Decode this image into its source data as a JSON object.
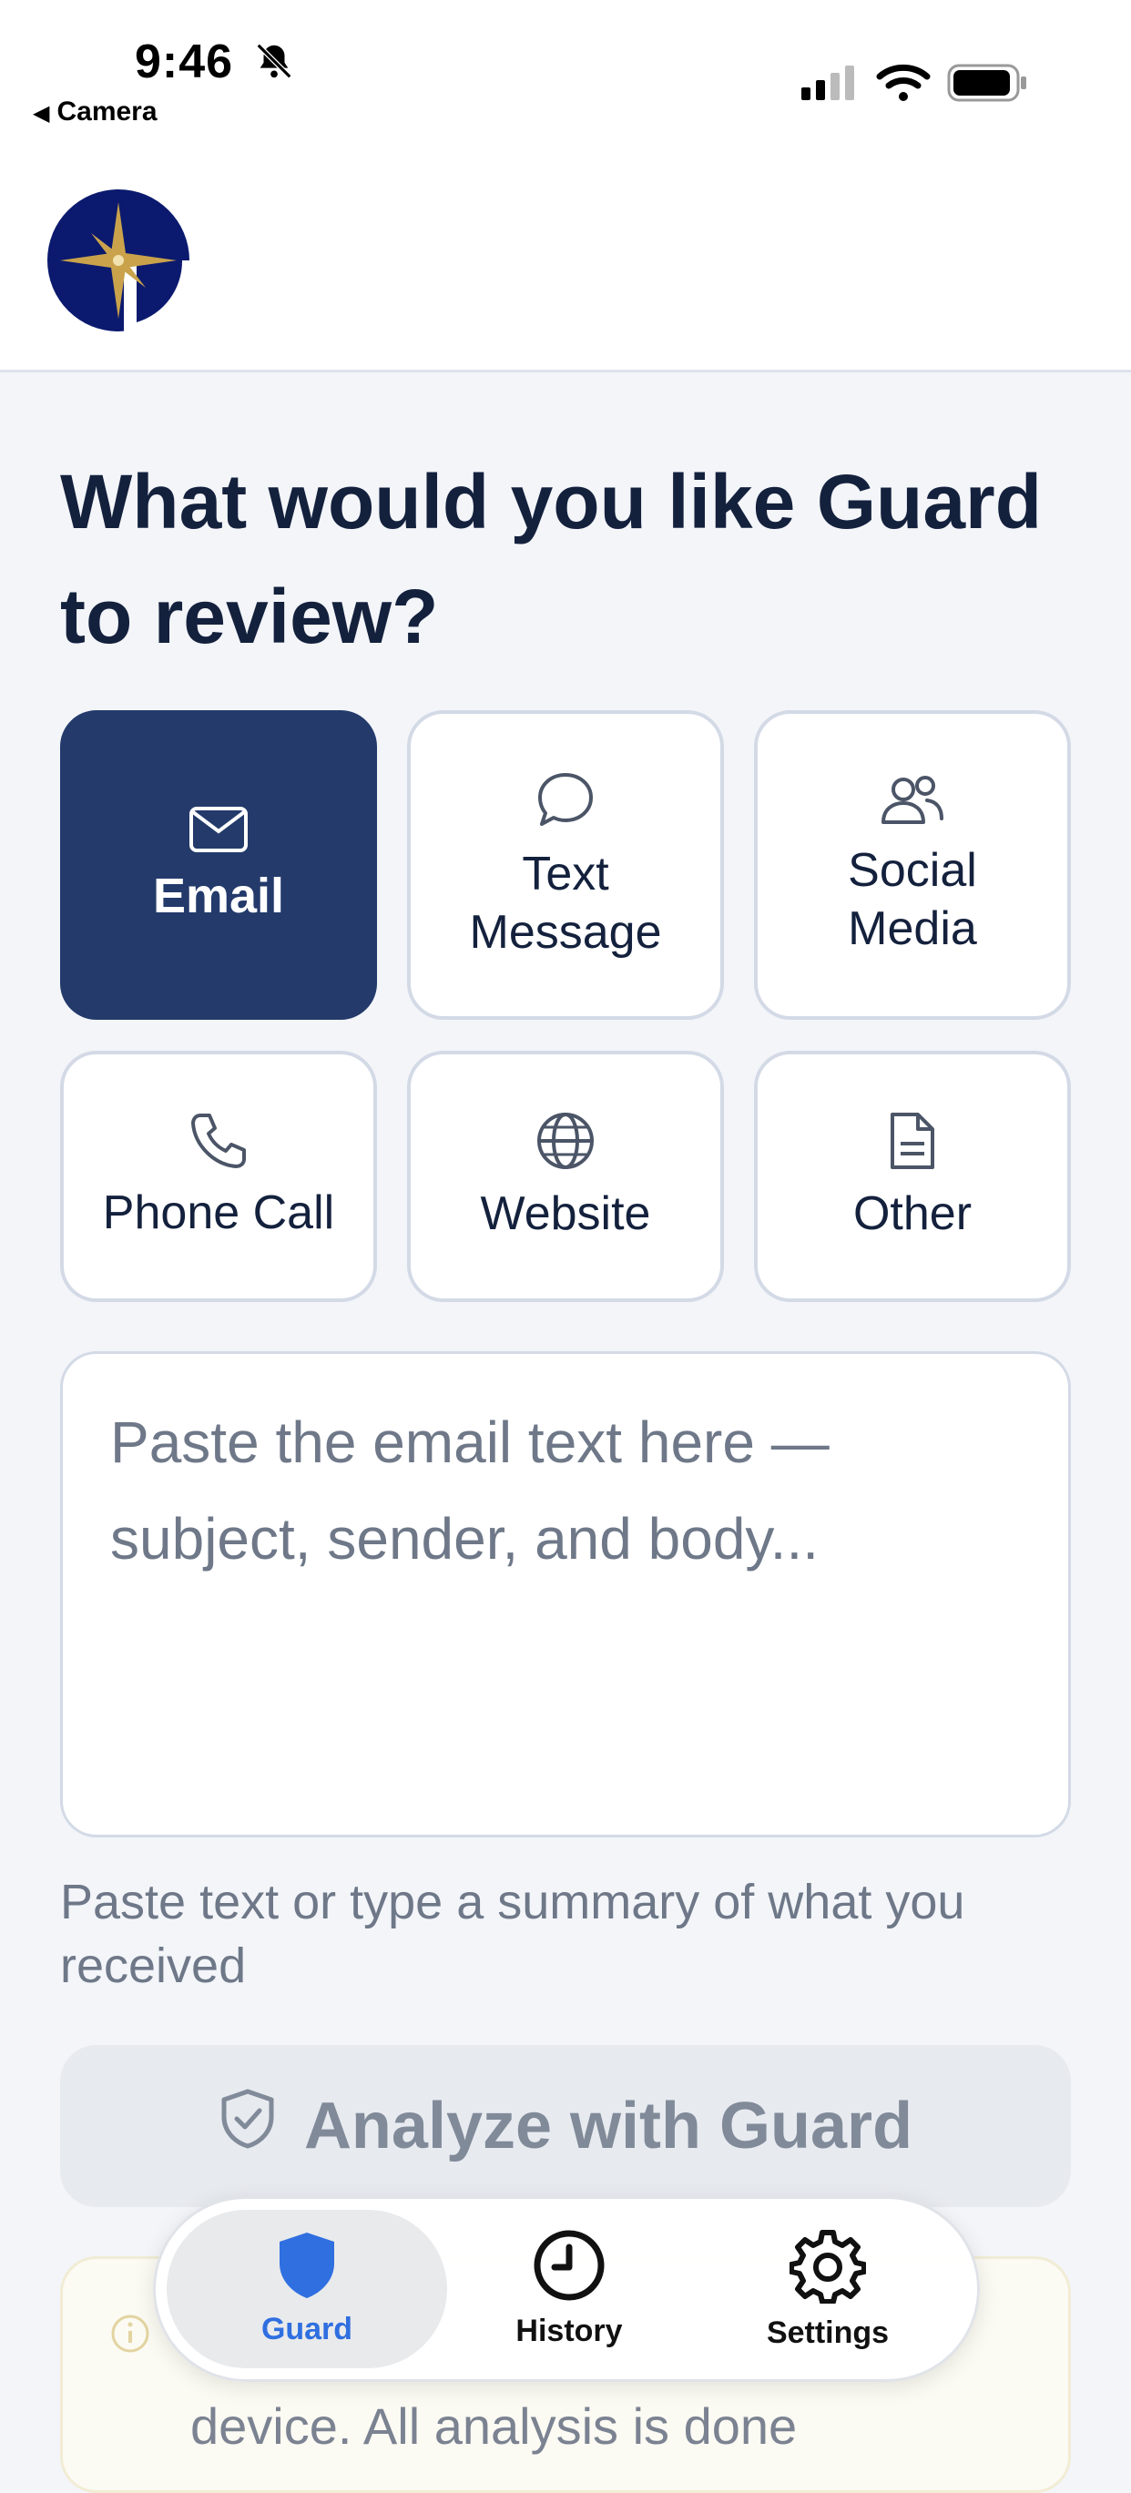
{
  "status_bar": {
    "time": "9:46",
    "back_label": "Camera"
  },
  "header": {
    "logo_icon": "compass-g-logo-icon"
  },
  "main": {
    "title": "What would you like Guard to review?",
    "options": [
      {
        "label": "Email",
        "icon": "mail-icon",
        "selected": true
      },
      {
        "label": "Text Message",
        "icon": "chat-bubble-icon",
        "selected": false
      },
      {
        "label": "Social Media",
        "icon": "people-icon",
        "selected": false
      },
      {
        "label": "Phone Call",
        "icon": "phone-icon",
        "selected": false
      },
      {
        "label": "Website",
        "icon": "globe-icon",
        "selected": false
      },
      {
        "label": "Other",
        "icon": "document-icon",
        "selected": false
      }
    ],
    "input": {
      "placeholder": "Paste the email text here — subject, sender, and body...",
      "value": ""
    },
    "hint": "Paste text or type a summary of what you received",
    "analyze_label": "Analyze with Guard",
    "notice_text": "device. All analysis is done"
  },
  "tabbar": {
    "tabs": [
      {
        "label": "Guard",
        "icon": "shield-icon",
        "active": true
      },
      {
        "label": "History",
        "icon": "clock-icon",
        "active": false
      },
      {
        "label": "Settings",
        "icon": "gear-icon",
        "active": false
      }
    ]
  },
  "colors": {
    "primary": "#233a6b",
    "accent_blue": "#2f6fe0",
    "background": "#f3f5f9",
    "muted_text": "#6e7888",
    "logo_gold": "#c9a24b",
    "logo_navy": "#0b1a6e"
  }
}
